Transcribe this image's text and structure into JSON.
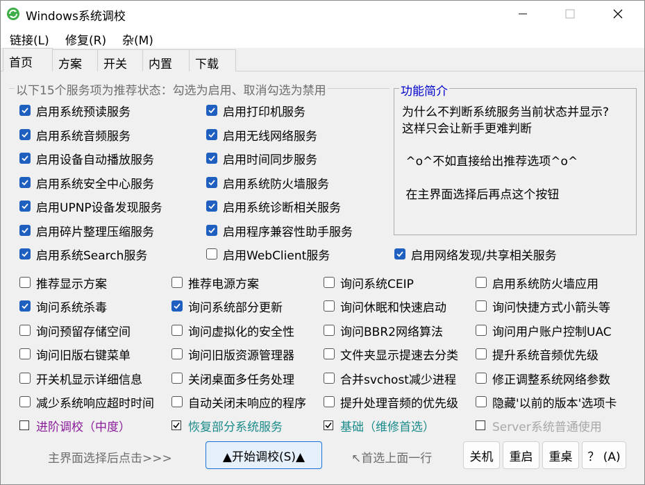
{
  "window": {
    "title": "Windows系统调校"
  },
  "menu": [
    "链接(L)",
    "修复(R)",
    "杂(M)"
  ],
  "tabs": [
    "首页",
    "方案",
    "开关",
    "内置",
    "下载"
  ],
  "services_group": {
    "label": "以下15个服务项为推荐状态：勾选为启用、取消勾选为禁用",
    "items": [
      {
        "label": "启用系统预读服务",
        "checked": true
      },
      {
        "label": "启用打印机服务",
        "checked": true
      },
      {
        "label": "启用系统音频服务",
        "checked": true
      },
      {
        "label": "启用无线网络服务",
        "checked": true
      },
      {
        "label": "启用设备自动播放服务",
        "checked": true
      },
      {
        "label": "启用时间同步服务",
        "checked": true
      },
      {
        "label": "启用系统安全中心服务",
        "checked": true
      },
      {
        "label": "启用系统防火墙服务",
        "checked": true
      },
      {
        "label": "启用UPNP设备发现服务",
        "checked": true
      },
      {
        "label": "启用系统诊断相关服务",
        "checked": true
      },
      {
        "label": "启用碎片整理压缩服务",
        "checked": true
      },
      {
        "label": "启用程序兼容性助手服务",
        "checked": true
      },
      {
        "label": "启用系统Search服务",
        "checked": true
      },
      {
        "label": "启用WebClient服务",
        "checked": false
      },
      {
        "label": "启用网络发现/共享相关服务",
        "checked": true
      }
    ]
  },
  "info": {
    "title": "功能简介",
    "lines": [
      "为什么不判断系统服务当前状态并显示?",
      "这样只会让新手更难判断",
      " ^o^不如直接给出推荐选项^o^",
      " 在主界面选择后再点这个按钮"
    ]
  },
  "options": [
    {
      "label": "推荐显示方案",
      "checked": false
    },
    {
      "label": "推荐电源方案",
      "checked": false
    },
    {
      "label": "询问系统CEIP",
      "checked": false
    },
    {
      "label": "启用系统防火墙应用",
      "checked": false
    },
    {
      "label": "询问系统杀毒",
      "checked": true
    },
    {
      "label": "询问系统部分更新",
      "checked": true
    },
    {
      "label": "询问休眠和快速启动",
      "checked": false
    },
    {
      "label": "询问快捷方式小箭头等",
      "checked": false
    },
    {
      "label": "询问预留存储空间",
      "checked": false
    },
    {
      "label": "询问虚拟化的安全性",
      "checked": false
    },
    {
      "label": "询问BBR2网络算法",
      "checked": false
    },
    {
      "label": "询问用户账户控制UAC",
      "checked": false
    },
    {
      "label": "询问旧版右键菜单",
      "checked": false
    },
    {
      "label": "询问旧版资源管理器",
      "checked": false
    },
    {
      "label": "文件夹显示提速去分类",
      "checked": false
    },
    {
      "label": "提升系统音频优先级",
      "checked": false
    },
    {
      "label": "开关机显示详细信息",
      "checked": false
    },
    {
      "label": "关闭桌面多任务处理",
      "checked": false
    },
    {
      "label": "合并svchost减少进程",
      "checked": false
    },
    {
      "label": "修正调整系统网络参数",
      "checked": false
    },
    {
      "label": "减少系统响应超时时间",
      "checked": false
    },
    {
      "label": "自动关闭未响应的程序",
      "checked": false
    },
    {
      "label": "提升处理音频的优先级",
      "checked": false
    },
    {
      "label": "隐藏'以前的版本'选项卡",
      "checked": false
    }
  ],
  "levels": [
    {
      "label": "进阶调校（中度）",
      "checked": false,
      "color": "#8b1a9b"
    },
    {
      "label": "恢复部分系统服务",
      "checked": true,
      "color": "#1a8a8a"
    },
    {
      "label": "基础（维修首选）",
      "checked": true,
      "color": "#1a8a8a"
    },
    {
      "label": "Server系统普通使用",
      "checked": false,
      "color": "#a8a8a8"
    }
  ],
  "footer": {
    "hint_left": "主界面选择后点击>>>",
    "start_button": "▲开始调校(S)▲",
    "hint_right": "↖首选上面一行",
    "shutdown": "关机",
    "restart": "重启",
    "reload_desktop": "重桌",
    "about": "？ (A)"
  },
  "colors": {
    "accent": "#1f5fbf",
    "info_title": "#0000cc",
    "hint_gray": "#6d6d6d"
  }
}
